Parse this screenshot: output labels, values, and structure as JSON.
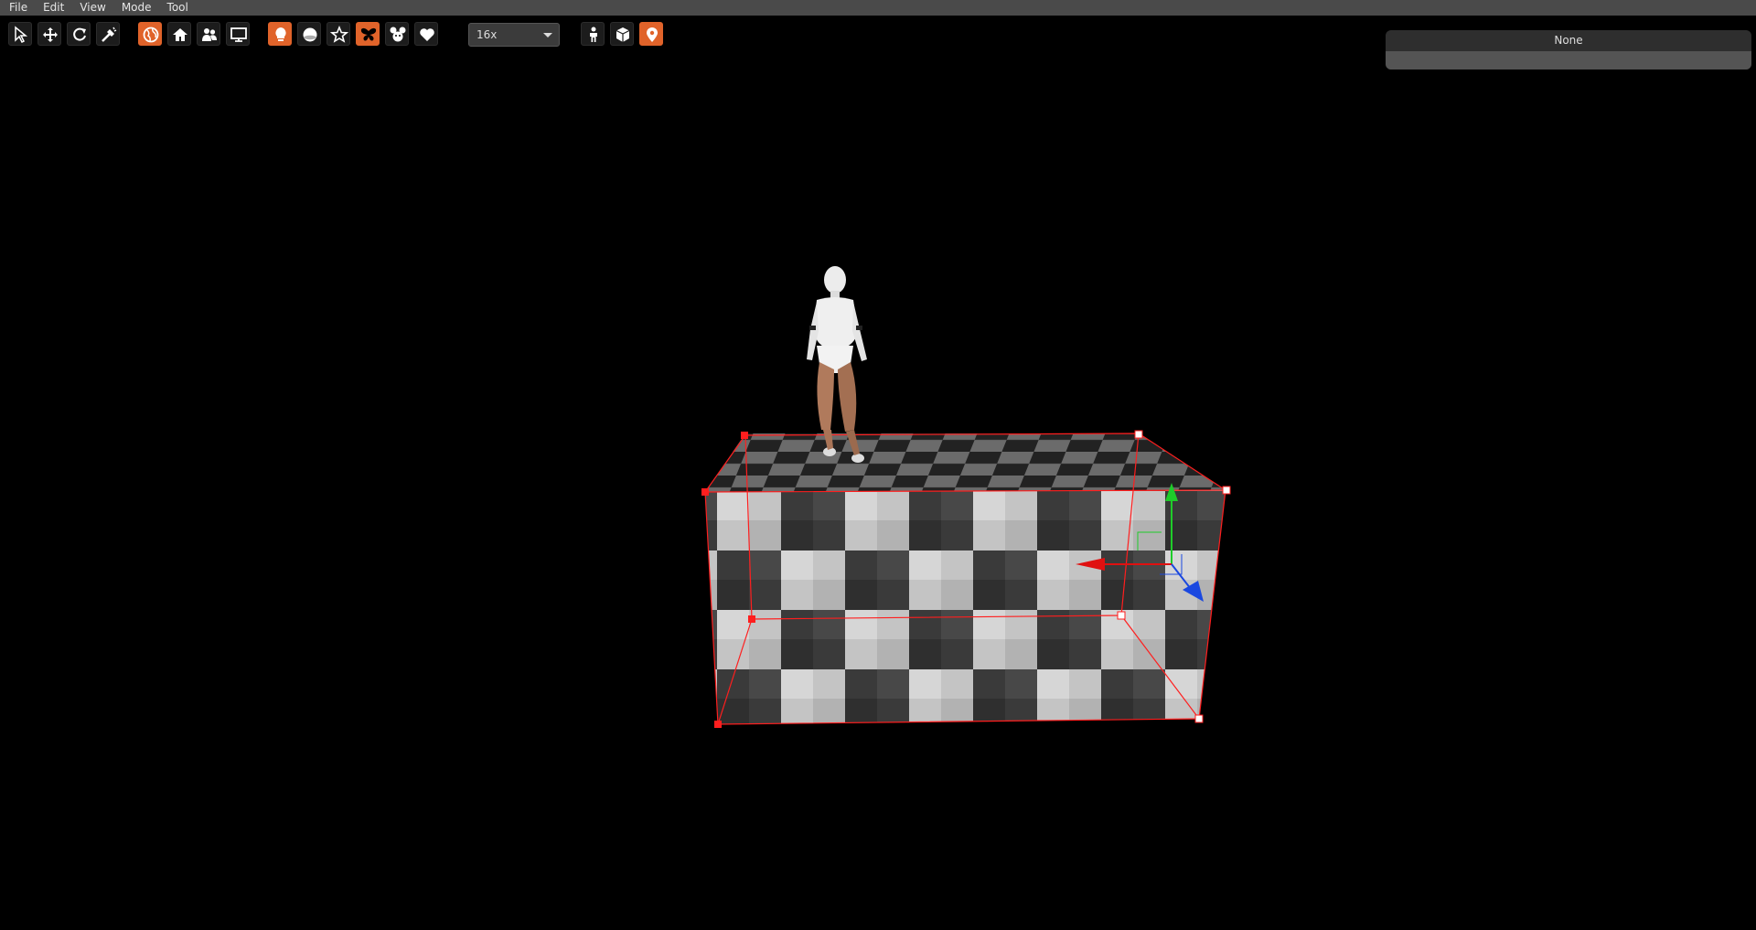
{
  "menu": {
    "items": [
      "File",
      "Edit",
      "View",
      "Mode",
      "Tool"
    ]
  },
  "toolbar": {
    "groups": [
      [
        {
          "icon": "select-arrow-icon",
          "active": false
        },
        {
          "icon": "move-icon",
          "active": true
        },
        {
          "icon": "rotate-icon",
          "active": false
        },
        {
          "icon": "wand-icon",
          "active": false
        }
      ],
      [
        {
          "icon": "globe-icon",
          "active": true
        },
        {
          "icon": "home-icon",
          "active": false
        },
        {
          "icon": "people-icon",
          "active": false
        },
        {
          "icon": "monitor-icon",
          "active": false
        }
      ],
      [
        {
          "icon": "lightbulb-icon",
          "active": true
        },
        {
          "icon": "sphere-icon",
          "active": false
        },
        {
          "icon": "star-icon",
          "active": false
        },
        {
          "icon": "butterfly-icon",
          "active": true
        },
        {
          "icon": "mouse-face-icon",
          "active": false
        },
        {
          "icon": "heart-icon",
          "active": false
        }
      ],
      [
        {
          "icon": "person-icon",
          "active": false
        },
        {
          "icon": "box-icon",
          "active": false
        },
        {
          "icon": "map-pin-icon",
          "active": true
        }
      ]
    ],
    "zoom_value": "16x"
  },
  "panel": {
    "title": "None"
  },
  "colors": {
    "accent": "#e0632a",
    "menubar": "#4a4a4a",
    "selection": "#ff1e1e"
  }
}
